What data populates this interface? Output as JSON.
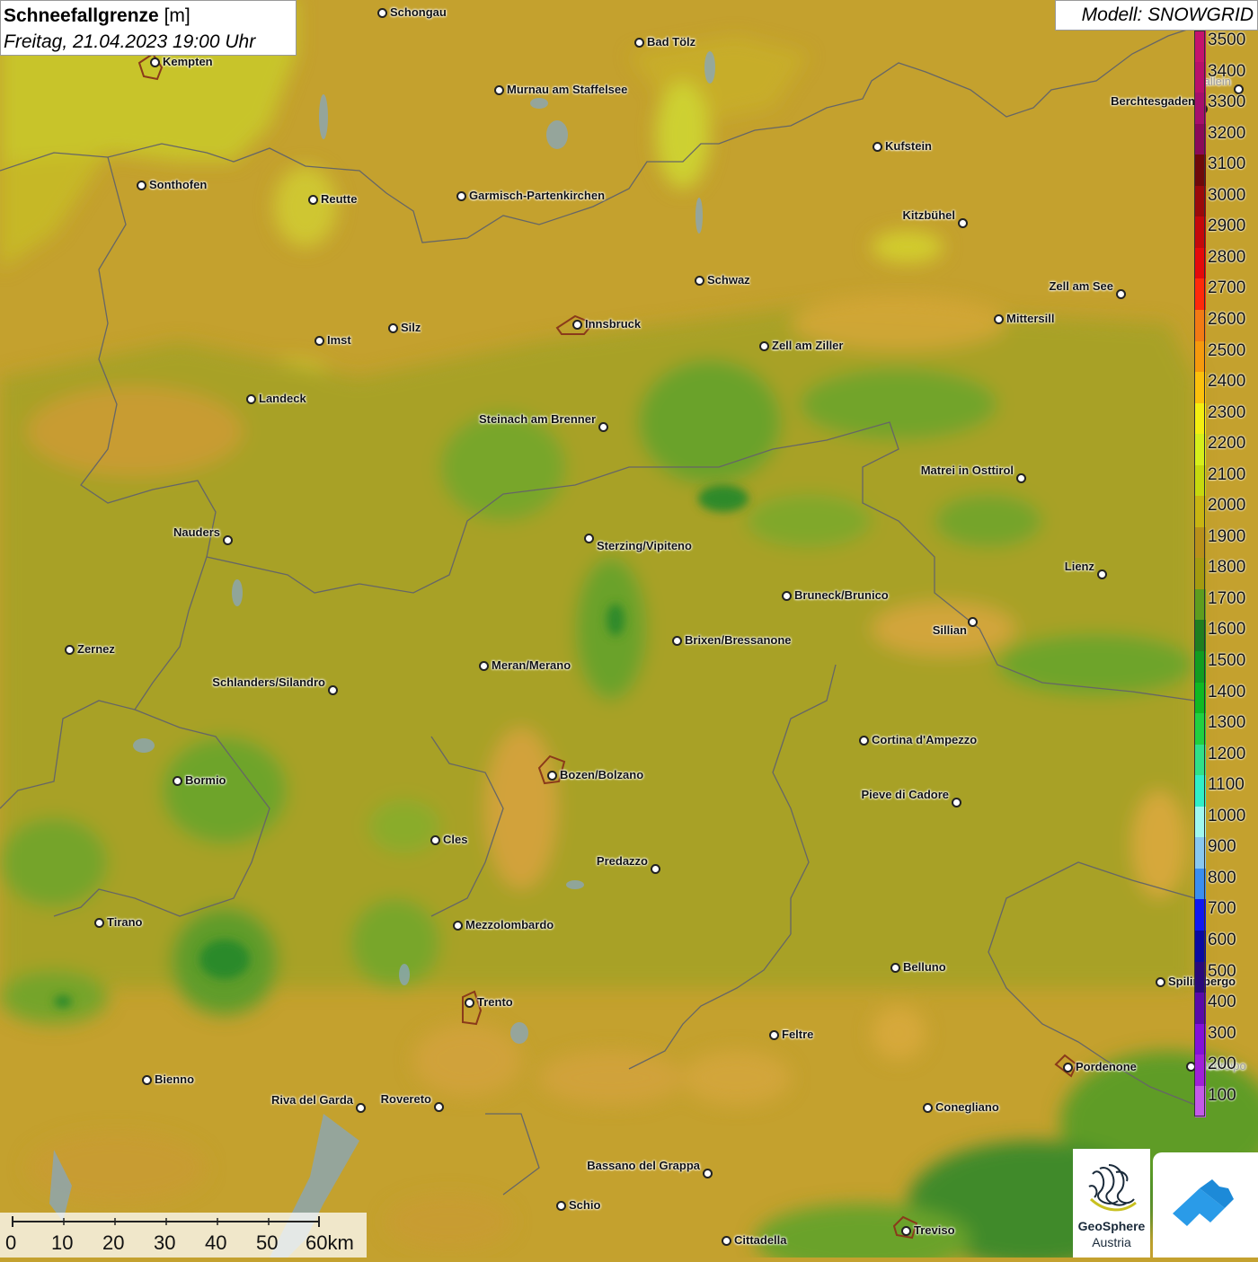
{
  "title": {
    "main_bold": "Schneefallgrenze",
    "main_unit": " [m]",
    "subtitle": "Freitag, 21.04.2023 19:00 Uhr"
  },
  "model": "Modell: SNOWGRID",
  "legend": {
    "labels": [
      "3500",
      "3400",
      "3300",
      "3200",
      "3100",
      "3000",
      "2900",
      "2800",
      "2700",
      "2600",
      "2500",
      "2400",
      "2300",
      "2200",
      "2100",
      "2000",
      "1900",
      "1800",
      "1700",
      "1600",
      "1500",
      "1400",
      "1300",
      "1200",
      "1100",
      "1000",
      "900",
      "800",
      "700",
      "600",
      "500",
      "400",
      "300",
      "200",
      "100"
    ],
    "colors": [
      "#c4146c",
      "#b8106a",
      "#a50f6b",
      "#8a0a58",
      "#6e0a0a",
      "#9a0a0a",
      "#c4080a",
      "#e40a0a",
      "#ff2a0a",
      "#f27a14",
      "#f5990d",
      "#fbc00c",
      "#f4ee10",
      "#d6ef1a",
      "#c6d80e",
      "#c8b412",
      "#b8901a",
      "#a49a10",
      "#5e9c1e",
      "#1f7d1f",
      "#119c20",
      "#0fb822",
      "#20d040",
      "#30e088",
      "#30efc8",
      "#a0f8f0",
      "#88c8f0",
      "#3a8ef0",
      "#1018f0",
      "#0a0aa0",
      "#2a0a7a",
      "#5a0aa8",
      "#8410d8",
      "#a020d8",
      "#c45ae8"
    ]
  },
  "scalebar": {
    "labels": [
      "0",
      "10",
      "20",
      "30",
      "40",
      "50",
      "60km"
    ]
  },
  "cities": [
    {
      "name": "Schongau"
    },
    {
      "name": "Kempten"
    },
    {
      "name": "Bad Tölz"
    },
    {
      "name": "Murnau am Staffelsee"
    },
    {
      "name": "Berchtesgaden"
    },
    {
      "name": "Sonthofen"
    },
    {
      "name": "Reutte"
    },
    {
      "name": "Garmisch-Partenkirchen"
    },
    {
      "name": "Kufstein"
    },
    {
      "name": "Kitzbühel"
    },
    {
      "name": "Schwaz"
    },
    {
      "name": "Zell am See"
    },
    {
      "name": "Innsbruck"
    },
    {
      "name": "Imst"
    },
    {
      "name": "Silz"
    },
    {
      "name": "Mittersill"
    },
    {
      "name": "Zell am Ziller"
    },
    {
      "name": "Landeck"
    },
    {
      "name": "Steinach am Brenner"
    },
    {
      "name": "Matrei in Osttirol"
    },
    {
      "name": "Nauders"
    },
    {
      "name": "Sterzing/Vipiteno"
    },
    {
      "name": "Lienz"
    },
    {
      "name": "Bruneck/Brunico"
    },
    {
      "name": "Sillian"
    },
    {
      "name": "Zernez"
    },
    {
      "name": "Brixen/Bressanone"
    },
    {
      "name": "Meran/Merano"
    },
    {
      "name": "Schlanders/Silandro"
    },
    {
      "name": "Cortina d'Ampezzo"
    },
    {
      "name": "Bozen/Bolzano"
    },
    {
      "name": "Bormio"
    },
    {
      "name": "Pieve di Cadore"
    },
    {
      "name": "Cles"
    },
    {
      "name": "Predazzo"
    },
    {
      "name": "Tirano"
    },
    {
      "name": "Mezzolombardo"
    },
    {
      "name": "Belluno"
    },
    {
      "name": "Spilimbergo"
    },
    {
      "name": "Trento"
    },
    {
      "name": "Feltre"
    },
    {
      "name": "Pordenone"
    },
    {
      "name": "Bienno"
    },
    {
      "name": "Riva del Garda"
    },
    {
      "name": "Rovereto"
    },
    {
      "name": "Conegliano"
    },
    {
      "name": "Bassano del Grappa"
    },
    {
      "name": "Schio"
    },
    {
      "name": "Treviso"
    },
    {
      "name": "Cittadella"
    },
    {
      "name": "Hallein"
    },
    {
      "name": "Codroipo"
    }
  ],
  "logos": {
    "geosphere_line1": "GeoSphere",
    "geosphere_line2": "Austria"
  }
}
